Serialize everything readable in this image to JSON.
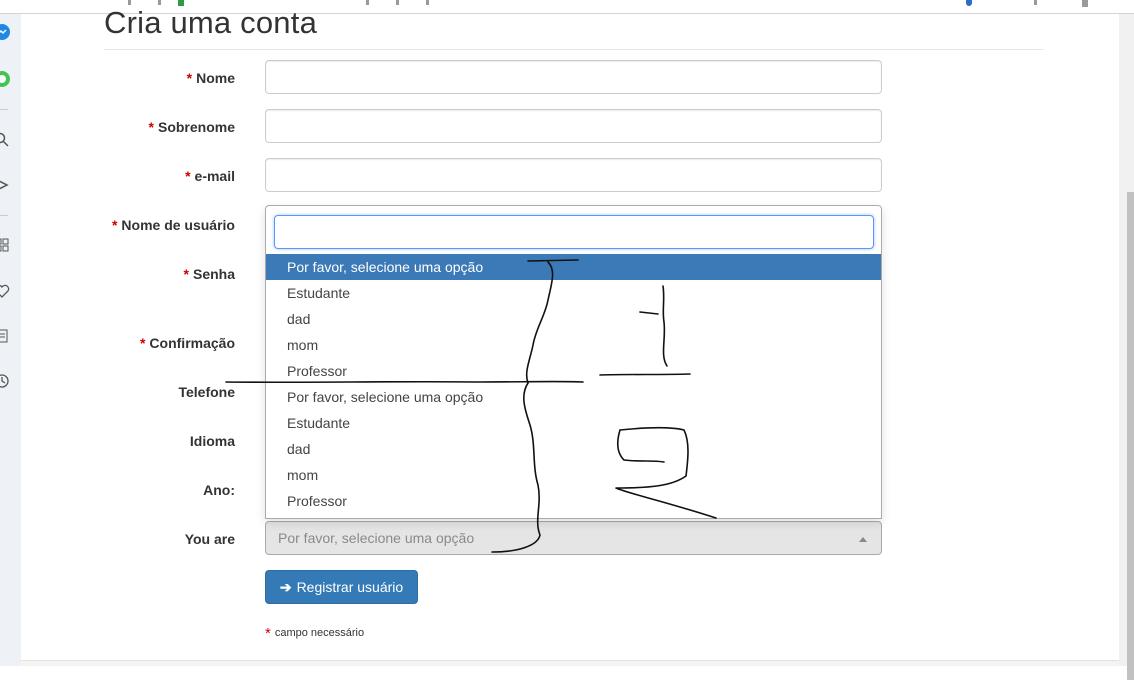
{
  "page": {
    "title": "Cria uma conta"
  },
  "form": {
    "required_marker": "*",
    "fields": [
      {
        "label": "Nome",
        "required": true,
        "value": ""
      },
      {
        "label": "Sobrenome",
        "required": true,
        "value": ""
      },
      {
        "label": "e-mail",
        "required": true,
        "value": ""
      },
      {
        "label": "Nome de usuário",
        "required": true,
        "value": ""
      },
      {
        "label": "Senha",
        "required": true,
        "value": ""
      },
      {
        "label": "Confirmação",
        "required": true,
        "value": ""
      },
      {
        "label": "Telefone",
        "required": false,
        "value": ""
      },
      {
        "label": "Idioma",
        "required": false,
        "value": ""
      },
      {
        "label": "Ano:",
        "required": false,
        "value": ""
      },
      {
        "label": "You are",
        "required": false,
        "value": ""
      }
    ],
    "you_are_select": {
      "placeholder": "Por favor, selecione uma opção",
      "search_value": "",
      "options": [
        "Por favor, selecione uma opção",
        "Estudante",
        "dad",
        "mom",
        "Professor",
        "Por favor, selecione uma opção",
        "Estudante",
        "dad",
        "mom",
        "Professor"
      ],
      "highlighted_index": 0
    },
    "submit_label": "Registrar usuário",
    "required_note": "campo necessário"
  },
  "colors": {
    "required": "#cc0000",
    "primary_button": "#337ab7",
    "highlight": "#3b79b7",
    "focus_border": "#5897fb"
  }
}
